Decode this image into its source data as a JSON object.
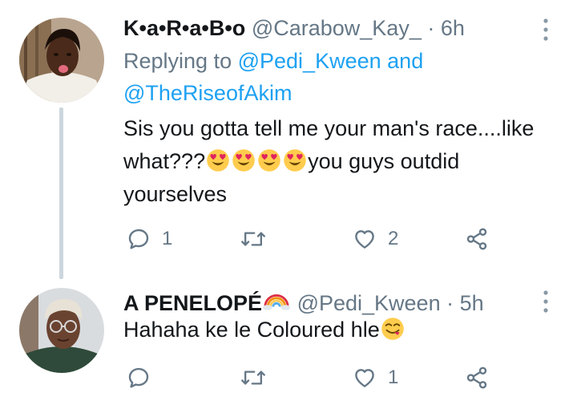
{
  "tweets": [
    {
      "display_name": "K•a•R•a•B•o",
      "handle": "@Carabow_Kay_",
      "separator": "·",
      "time": "6h",
      "replying_to_prefix": "Replying to",
      "replying_to_mentions": [
        "@Pedi_Kween",
        "@TheRiseofAkim"
      ],
      "replying_to_joiner": "and",
      "text_before_emoji": "Sis you gotta tell me your man's race....like what???",
      "emoji_name": "smiling-face-with-heart-eyes",
      "emoji_count": 4,
      "text_after_emoji": "you guys outdid yourselves",
      "reply_count": "1",
      "retweet_count": "",
      "like_count": "2"
    },
    {
      "display_name": "A PENELOPÉ",
      "name_emoji": "rainbow",
      "handle": "@Pedi_Kween",
      "separator": "·",
      "time": "5h",
      "text": "Hahaha ke le Coloured hle",
      "emoji_name": "face-savoring-food",
      "reply_count": "",
      "retweet_count": "",
      "like_count": "1"
    }
  ],
  "icons": {
    "reply": "reply-icon",
    "retweet": "retweet-icon",
    "like": "heart-icon",
    "share": "share-icon",
    "more": "more-vertical-icon"
  },
  "colors": {
    "text": "#14171a",
    "secondary": "#657786",
    "link": "#1da1f2",
    "thread_line": "#ccd6dd",
    "background": "#ffffff"
  }
}
